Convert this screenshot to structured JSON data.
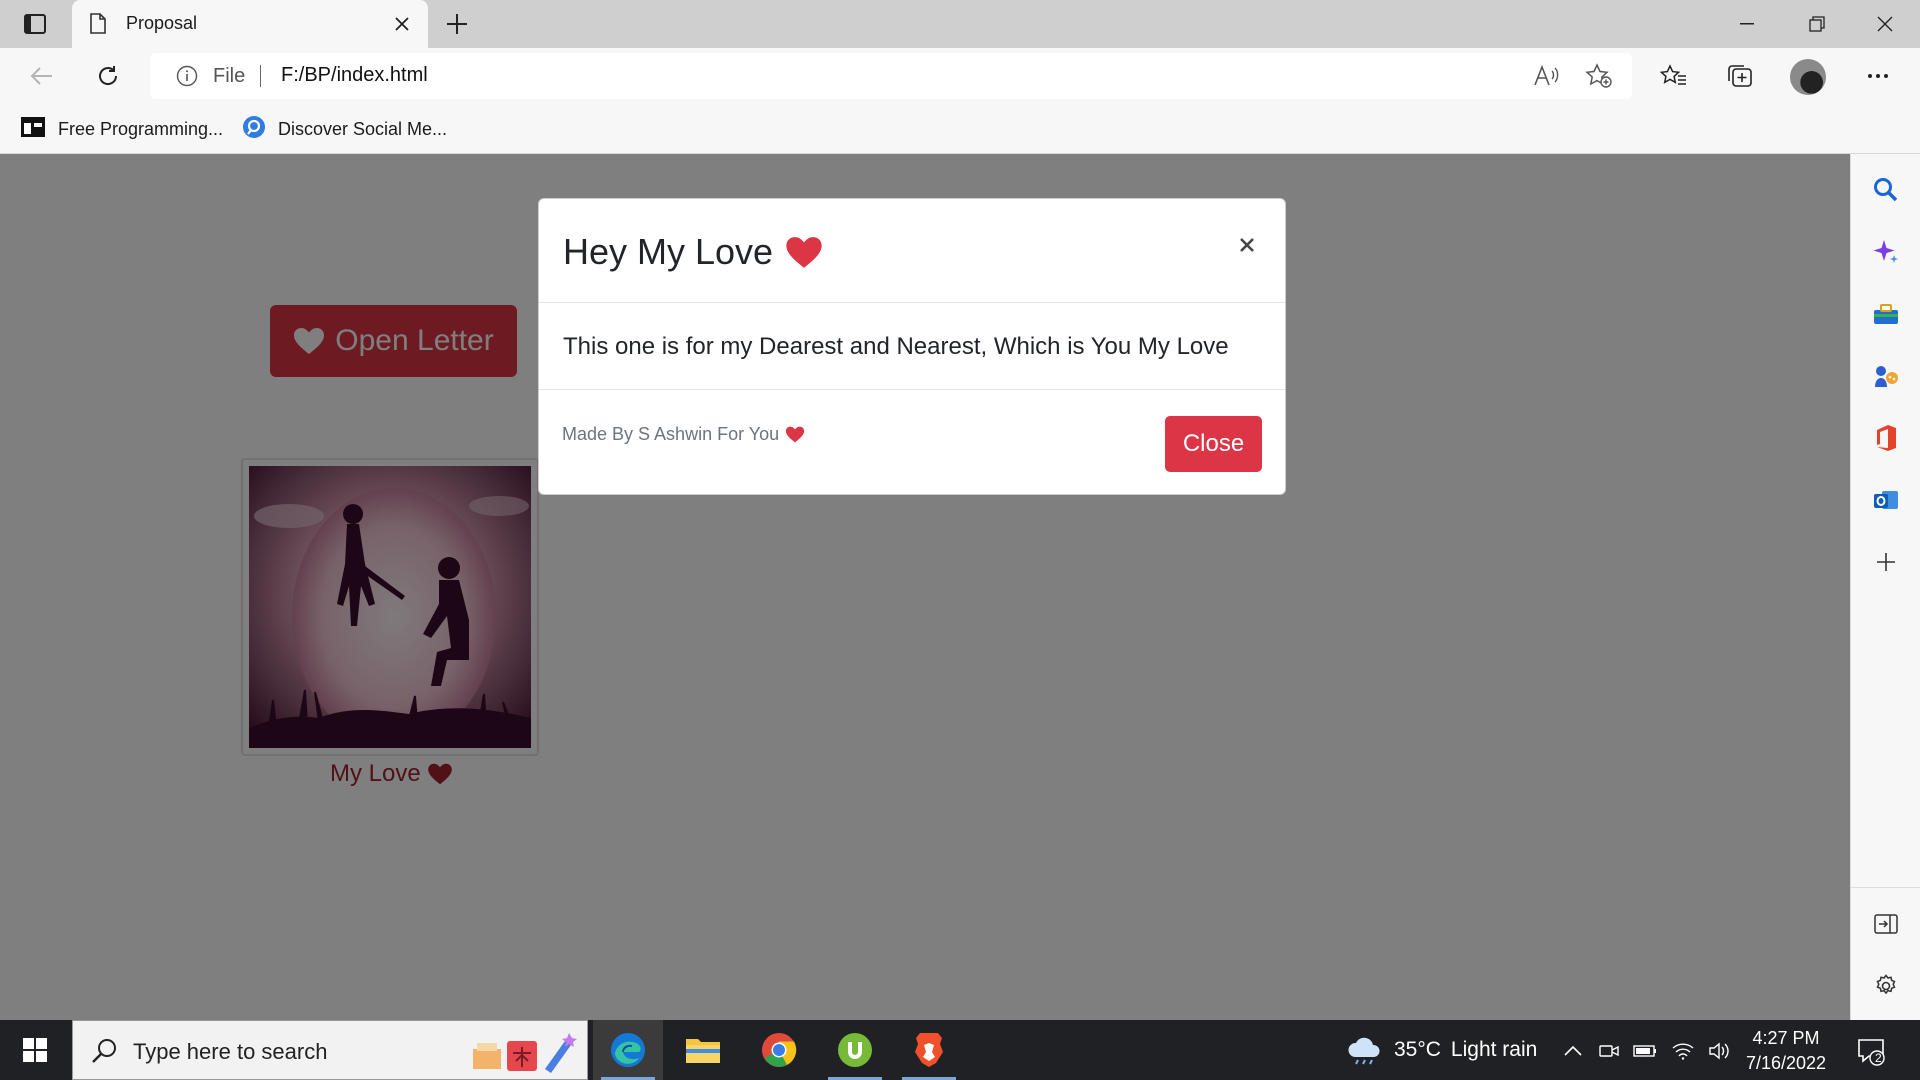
{
  "browser": {
    "tab": {
      "title": "Proposal"
    },
    "address": {
      "scheme_label": "File",
      "url": "F:/BP/index.html"
    },
    "bookmarks": [
      {
        "label": "Free Programming...",
        "icon": "bookmark-site-icon"
      },
      {
        "label": "Discover Social Me...",
        "icon": "social-site-icon"
      }
    ]
  },
  "page": {
    "open_letter_label": "Open Letter",
    "photo_caption": "My Love",
    "photo_alt": "couple-proposal-silhouette"
  },
  "modal": {
    "title": "Hey My Love",
    "body": "This one is for my Dearest and Nearest, Which is You My Love",
    "credit": "Made By S Ashwin For You",
    "close_label": "Close"
  },
  "taskbar": {
    "search_placeholder": "Type here to search",
    "weather": {
      "temp": "35°C",
      "condition": "Light rain"
    },
    "time": "4:27 PM",
    "date": "7/16/2022",
    "notification_count": "2"
  },
  "colors": {
    "accent": "#dc3545",
    "heart": "#dc3545",
    "caption": "#a4212f",
    "backdrop": "rgba(0,0,0,0.5)"
  }
}
